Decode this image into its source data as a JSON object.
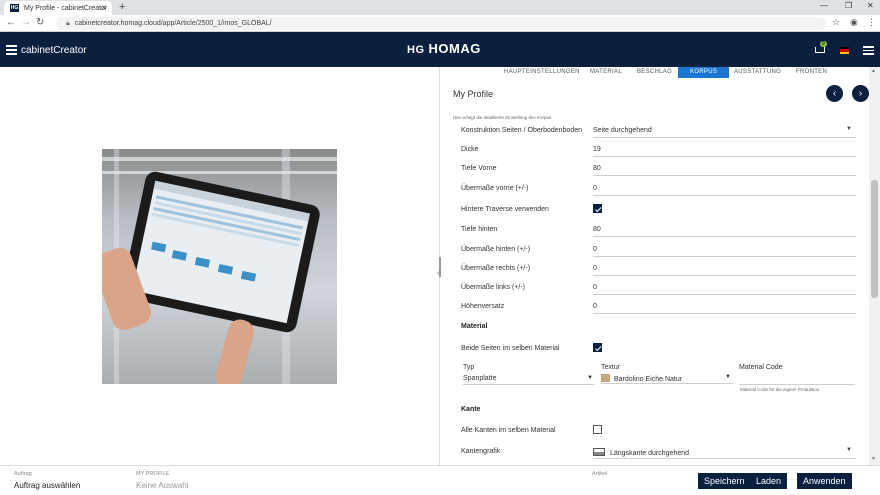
{
  "browser": {
    "tab_title": "My Profile - cabinetCreator",
    "tab_favicon": "HG",
    "url": "cabinetcreator.homag.cloud/app/Article/2500_1/imos_GLOBAL/"
  },
  "app": {
    "brand": "cabinetCreator",
    "logo_text": "HOMAG",
    "logo_mark": "HG",
    "cart_count": "0"
  },
  "steps": [
    "HAUPTEINSTELLUNGEN",
    "MATERIAL",
    "BESCHLAG",
    "KORPUS",
    "AUSSTATTUNG",
    "FRONTEN"
  ],
  "active_step": "KORPUS",
  "panel": {
    "title": "My Profile",
    "hint": "Hier erfolgt die detaillierte Einstellung des Korpus.",
    "fields": [
      {
        "label": "Konstruktion Seiten / Oberbodenboden",
        "value": "Seite durchgehend",
        "dropdown": true
      },
      {
        "label": "Dicke",
        "value": "19"
      },
      {
        "label": "Tiefe Vorne",
        "value": "80"
      },
      {
        "label": "Übermaße vorne (+/-)",
        "value": "0"
      },
      {
        "label": "Hintere Traverse verwenden",
        "checked": true
      },
      {
        "label": "Tiefe hinten",
        "value": "80"
      },
      {
        "label": "Übermaße hinten (+/-)",
        "value": "0"
      },
      {
        "label": "Übermaße rechts (+/-)",
        "value": "0"
      },
      {
        "label": "Übermaße links (+/-)",
        "value": "0"
      },
      {
        "label": "Höhenversatz",
        "value": "0"
      }
    ],
    "material": {
      "heading": "Material",
      "same_label": "Beide Seiten im selben Material",
      "same_checked": true,
      "typ_label": "Typ",
      "typ_value": "Spanplatte",
      "textur_label": "Textur",
      "textur_value": "Bardolino Eiche Natur",
      "code_label": "Material Code",
      "code_hint": "Material Code für die eigene Produktion"
    },
    "kante": {
      "heading": "Kante",
      "same_label": "Alle Kanten im selben Material",
      "same_checked": false,
      "grafik_label": "Kantengrafik",
      "grafik_value": "Längskante durchgehend"
    }
  },
  "footer": {
    "auftrag_caption": "Auftrag",
    "auftrag_value": "Auftrag auswählen",
    "profile_caption": "MY PROFILE",
    "profile_value": "Keine Auswahl",
    "artikel_caption": "Artikel",
    "save_label": "Speichern",
    "load_label": "Laden",
    "apply_label": "Anwenden"
  },
  "colors": {
    "navy": "#0b1f3f",
    "accent": "#1976d2",
    "badge": "#8cc63f"
  }
}
